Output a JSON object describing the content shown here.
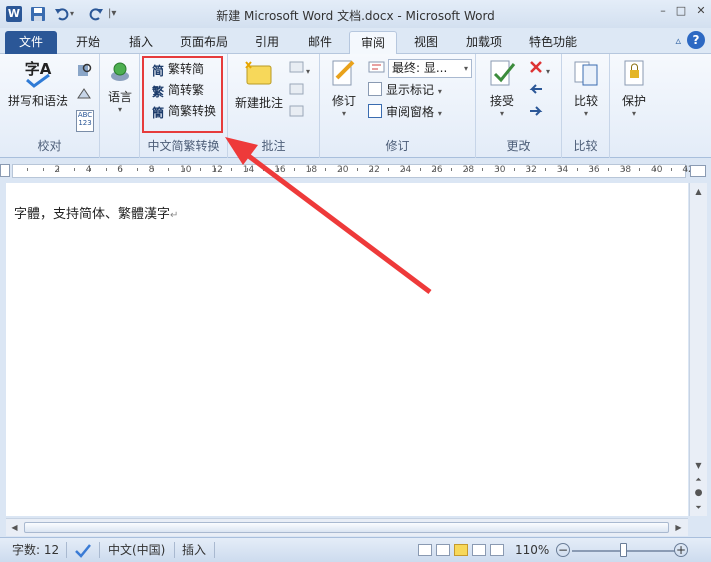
{
  "window": {
    "title": "新建 Microsoft Word 文档.docx - Microsoft Word",
    "word_icon_letter": "W",
    "controls": {
      "minimize": "–",
      "restore": "□",
      "close": "✕"
    }
  },
  "tabs": {
    "file": "文件",
    "items": [
      "开始",
      "插入",
      "页面布局",
      "引用",
      "邮件",
      "审阅",
      "视图",
      "加载项",
      "特色功能"
    ],
    "active": "审阅",
    "help": "?"
  },
  "ribbon": {
    "proofing": {
      "label": "校对",
      "spelling": "拼写和语法",
      "spelling_icon_text": "字A",
      "abc": "ABC\n123"
    },
    "language": {
      "label": "语言",
      "group_label": ""
    },
    "chinese_conversion": {
      "label": "中文简繁转换",
      "to_traditional_simplified": "繁转简",
      "to_traditional": "简转繁",
      "convert": "简繁转换",
      "icon1": "简",
      "icon2": "繁",
      "icon3": "簡"
    },
    "comments": {
      "label": "批注",
      "new_comment": "新建批注"
    },
    "tracking": {
      "label": "修订",
      "track_changes": "修订",
      "display": "最终: 显...",
      "show_markup": "显示标记",
      "reviewing_pane": "审阅窗格"
    },
    "changes": {
      "label": "更改",
      "accept": "接受"
    },
    "compare": {
      "label": "比较",
      "compare": "比较"
    },
    "protect": {
      "label": "",
      "protect": "保护"
    }
  },
  "ruler": {
    "numbers": [
      "2",
      "4",
      "6",
      "8",
      "10",
      "12",
      "14",
      "16",
      "18",
      "20",
      "22",
      "24",
      "26",
      "28",
      "30",
      "32",
      "34",
      "36",
      "38",
      "40",
      "42"
    ]
  },
  "document": {
    "text": "字體，支持简体、繁體漢字",
    "paragraph_mark": "↵"
  },
  "statusbar": {
    "word_count": "字数: 12",
    "language": "中文(中国)",
    "insert_mode": "插入",
    "zoom": "110%",
    "zoom_value_percent": 110
  },
  "colors": {
    "accent": "#2b5797",
    "highlight": "#e63b3b",
    "ribbon_bg": "#e3ecf8"
  }
}
